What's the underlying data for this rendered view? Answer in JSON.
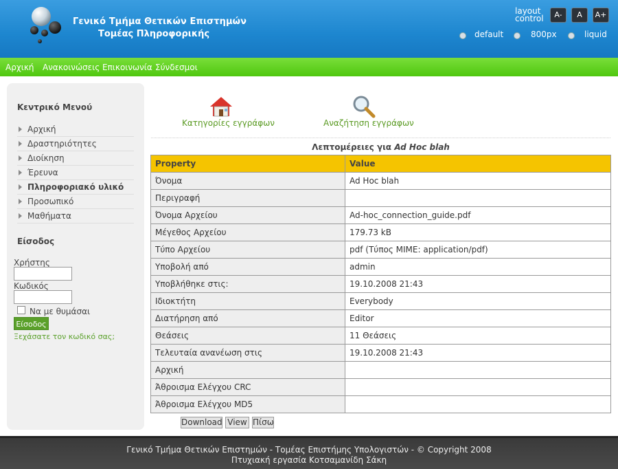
{
  "header": {
    "title_line1": "Γενικό Τμήμα Θετικών Επιστημών",
    "title_line2": "Τομέας Πληροφορικής",
    "layout_control_line1": "layout",
    "layout_control_line2": "control",
    "font_buttons": [
      "A-",
      "A",
      "A+"
    ],
    "layout_options": [
      "default",
      "800px",
      "liquid"
    ]
  },
  "nav": {
    "items": [
      "Αρχική",
      "Ανακοινώσεις",
      "Επικοινωνία",
      "Σύνδεσμοι"
    ]
  },
  "sidebar": {
    "menu_heading": "Κεντρικό Μενού",
    "menu_items": [
      "Αρχική",
      "Δραστηριότητες",
      "Διοίκηση",
      "Έρευνα",
      "Πληροφοριακό υλικό",
      "Προσωπικό",
      "Μαθήματα"
    ],
    "login_heading": "Είσοδος",
    "username_label": "Χρήστης",
    "password_label": "Κωδικός",
    "remember_label": "Να με θυμάσαι",
    "login_button": "Είσοδος",
    "forgot_link": "Ξεχάσατε τον κωδικό σας;"
  },
  "content": {
    "categories_link": "Κατηγορίες εγγράφων",
    "search_link": "Αναζήτηση εγγράφων",
    "details_prefix": "Λεπτομέρειες για",
    "details_name": "Ad Hoc blah",
    "table_header": {
      "property": "Property",
      "value": "Value"
    },
    "rows": [
      {
        "property": "Όνομα",
        "value": "Ad Hoc blah"
      },
      {
        "property": "Περιγραφή",
        "value": ""
      },
      {
        "property": "Όνομα Αρχείου",
        "value": "Ad-hoc_connection_guide.pdf"
      },
      {
        "property": "Μέγεθος Αρχείου",
        "value": "179.73 kB"
      },
      {
        "property": "Τύπο Αρχείου",
        "value": "pdf (Τύπος MIME: application/pdf)"
      },
      {
        "property": "Υποβολή από",
        "value": "admin"
      },
      {
        "property": "Υποβλήθηκε στις:",
        "value": "19.10.2008 21:43"
      },
      {
        "property": "Ιδιοκτήτη",
        "value": "Everybody"
      },
      {
        "property": "Διατήρηση από",
        "value": "Editor"
      },
      {
        "property": "Θεάσεις",
        "value": "11 Θεάσεις"
      },
      {
        "property": "Τελευταία ανανέωση στις",
        "value": "19.10.2008 21:43"
      },
      {
        "property": "Αρχική",
        "value": ""
      },
      {
        "property": "Άθροισμα Ελέγχου CRC",
        "value": ""
      },
      {
        "property": "Άθροισμα Ελέγχου MD5",
        "value": ""
      }
    ],
    "buttons": {
      "download": "Download",
      "view": "View",
      "back": "Πίσω"
    }
  },
  "footer": {
    "line1": "Γενικό Τμήμα Θετικών Επιστημών - Τομέας Επιστήμης Υπολογιστών - © Copyright 2008",
    "line2": "Πτυχιακή εργασία Κοτσαμανίδη Σάκη"
  }
}
